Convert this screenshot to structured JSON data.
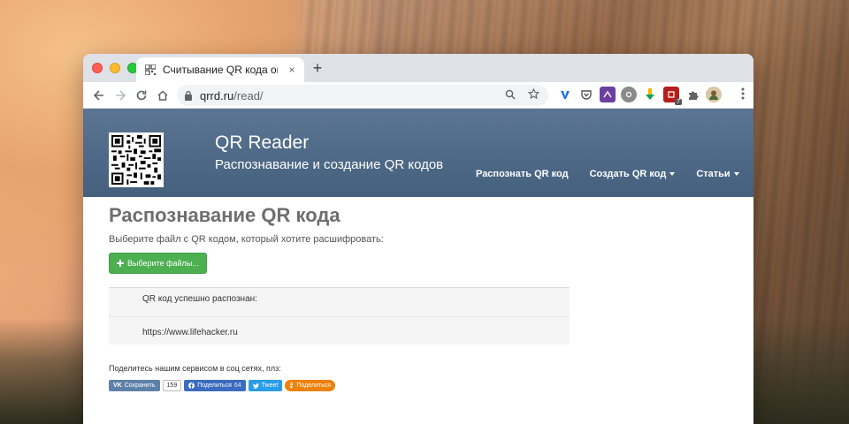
{
  "browser": {
    "tab_title": "Считывание QR кода онлайн",
    "tab_close": "×",
    "new_tab": "+",
    "url_host": "qrrd.ru",
    "url_path": "/read/",
    "ext_badge": "7"
  },
  "site": {
    "title": "QR Reader",
    "subtitle": "Распознавание и создание QR кодов",
    "nav": [
      "Распознать QR код",
      "Создать QR код",
      "Статьи"
    ]
  },
  "main": {
    "heading": "Распознавание QR кода",
    "lead": "Выберите файл с QR кодом, который хотите расшифровать:",
    "file_button": "Выберите файлы...",
    "result_label": "QR код успешно распознан:",
    "result_value": "https://www.lifehacker.ru",
    "share_prompt": "Поделитесь нашим сервисом в соц сетях, плз:",
    "share": {
      "vk": "Сохранить",
      "vk_count": "159",
      "fb": "Поделиться",
      "fb_count": "64",
      "tw": "Tweet",
      "ok": "Поделиться"
    }
  },
  "colors": {
    "header_bg": "#4f6a88",
    "file_button": "#4caf50"
  }
}
